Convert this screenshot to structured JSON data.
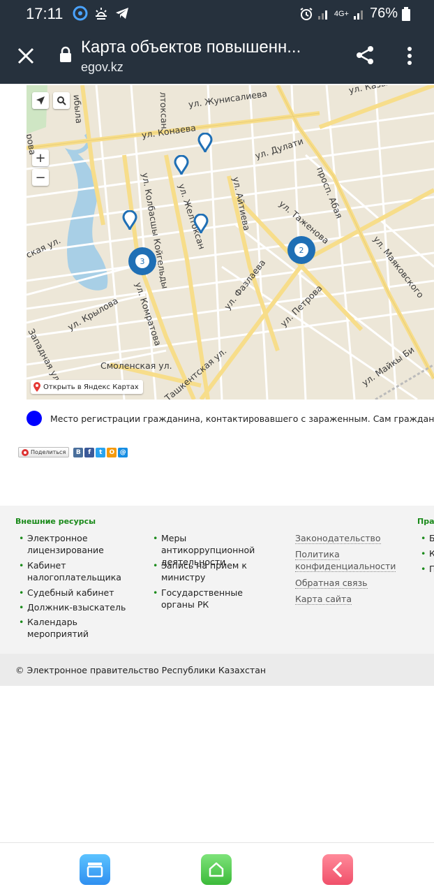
{
  "status_bar": {
    "time": "17:11",
    "network": "4G+",
    "battery": "76%"
  },
  "app_bar": {
    "title": "Карта объектов повышенн...",
    "subtitle": "egov.kz",
    "icons": [
      "close-icon",
      "lock-icon",
      "share-icon",
      "more-icon"
    ]
  },
  "map": {
    "streets": [
      "ул. Казыбек Би",
      "ул. Жунисалиева",
      "ул. Конаева",
      "ул. Дулати",
      "ул. Колбасшы Койгельды",
      "ул. Желтоксан",
      "ул. Айтиева",
      "просп. Абая",
      "ул. Таженова",
      "ул. Маяковского",
      "ул. Фазлаева",
      "ул. Петрова",
      "ул. Комратова",
      "ул. Крылова",
      "Западная ул.",
      "Смоленская ул.",
      "Ташкентская ул.",
      "ул. Майкы Би",
      "ская ул.",
      "ибыла",
      "лтоксан",
      "рова"
    ],
    "clusters": [
      "3",
      "2"
    ],
    "zoom_in": "+",
    "zoom_out": "−",
    "open_in_yandex": "Открыть в Яндекс Картах"
  },
  "legend": {
    "color": "#0000ff",
    "text": "Место регистрации гражданина, контактировавшего с зараженным. Сам гражданин может нах"
  },
  "share": {
    "button_label": "Поделиться",
    "networks": [
      "В",
      "f",
      "t",
      "О",
      "@"
    ]
  },
  "footer": {
    "col1_title": "Внешние ресурсы",
    "col1_items": [
      "Электронное лицензирование",
      "Кабинет налогоплательщика",
      "Судебный кабинет",
      "Должник-взыскатель",
      "Календарь мероприятий"
    ],
    "col2_items": [
      "Меры антикоррупционной деятельности",
      "Запись на прием к министру",
      "Государственные органы РК"
    ],
    "col3_items": [
      "Законодательство",
      "Политика конфиденциальности",
      "Обратная связь",
      "Карта сайта"
    ],
    "col4_title": "Прав",
    "col4_items": [
      "Б",
      "К",
      "П"
    ],
    "copyright": "© Электронное правительство Республики Казахстан"
  },
  "colors": {
    "app_bar": "#26313d",
    "cluster": "#1f6fb5",
    "footer_accent": "#1a8a1a"
  }
}
